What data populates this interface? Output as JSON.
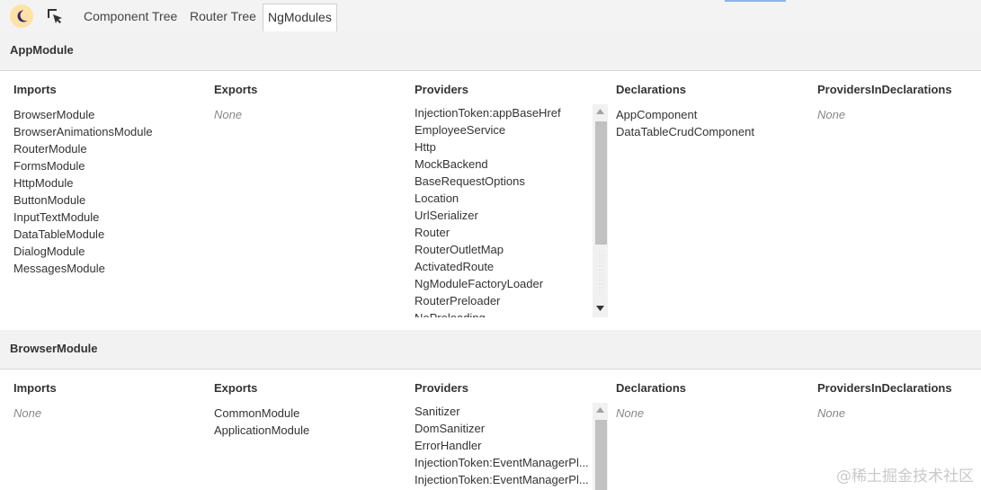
{
  "toolbar": {
    "tabs": [
      {
        "label": "Component Tree"
      },
      {
        "label": "Router Tree"
      },
      {
        "label": "NgModules"
      }
    ],
    "active_tab": "NgModules",
    "icons": {
      "theme": "moon-icon",
      "inspect": "cursor-inspect-icon"
    }
  },
  "labels": {
    "imports": "Imports",
    "exports": "Exports",
    "providers": "Providers",
    "declarations": "Declarations",
    "providers_in_declarations": "ProvidersInDeclarations",
    "none": "None"
  },
  "modules": [
    {
      "title": "AppModule",
      "imports": [
        "BrowserModule",
        "BrowserAnimationsModule",
        "RouterModule",
        "FormsModule",
        "HttpModule",
        "ButtonModule",
        "InputTextModule",
        "DataTableModule",
        "DialogModule",
        "MessagesModule"
      ],
      "exports": [],
      "providers": [
        "InjectionToken:appBaseHref",
        "EmployeeService",
        "Http",
        "MockBackend",
        "BaseRequestOptions",
        "Location",
        "UrlSerializer",
        "Router",
        "RouterOutletMap",
        "ActivatedRoute",
        "NgModuleFactoryLoader",
        "RouterPreloader",
        "NoPreloading"
      ],
      "declarations": [
        "AppComponent",
        "DataTableCrudComponent"
      ],
      "providers_in_declarations": []
    },
    {
      "title": "BrowserModule",
      "imports": [],
      "exports": [
        "CommonModule",
        "ApplicationModule"
      ],
      "providers": [
        "Sanitizer",
        "DomSanitizer",
        "ErrorHandler",
        "InjectionToken:EventManagerPl...",
        "InjectionToken:EventManagerPl..."
      ],
      "declarations": [],
      "providers_in_declarations": []
    }
  ],
  "watermark": "@稀土掘金技术社区"
}
